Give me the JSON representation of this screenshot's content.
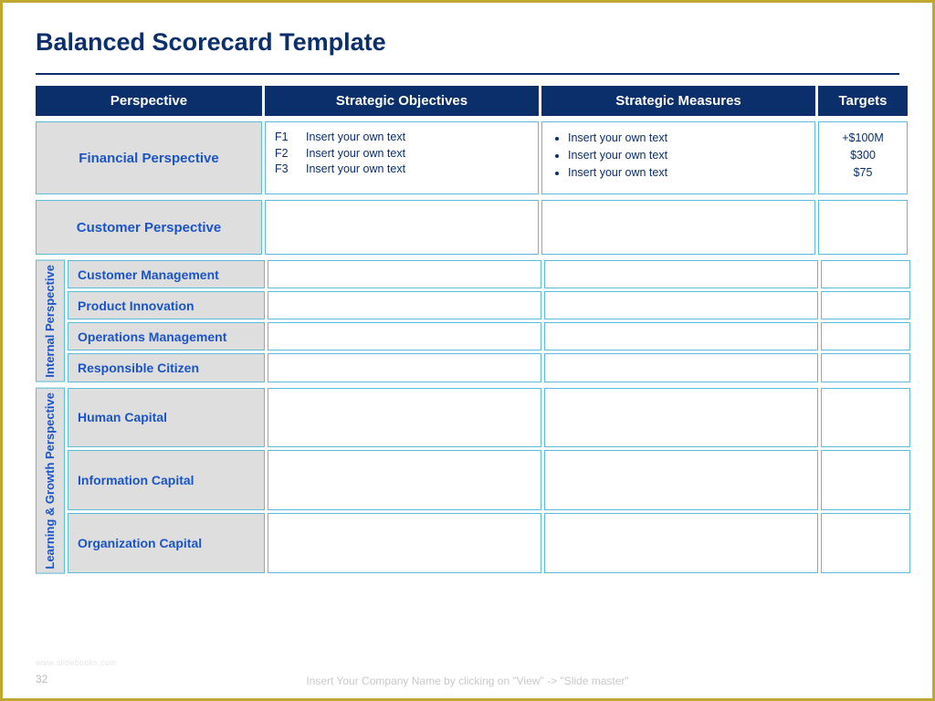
{
  "title": "Balanced Scorecard Template",
  "headers": {
    "perspective": "Perspective",
    "objectives": "Strategic Objectives",
    "measures": "Strategic Measures",
    "targets": "Targets"
  },
  "financial": {
    "label": "Financial Perspective",
    "objectives": [
      {
        "key": "F1",
        "text": "Insert your own text"
      },
      {
        "key": "F2",
        "text": "Insert your own text"
      },
      {
        "key": "F3",
        "text": "Insert your own text"
      }
    ],
    "measures": [
      "Insert your own text",
      "Insert your own text",
      "Insert your own text"
    ],
    "targets": [
      "+$100M",
      "$300",
      "$75"
    ]
  },
  "customer": {
    "label": "Customer Perspective"
  },
  "internal": {
    "vertical_label": "Internal Perspective",
    "rows": [
      "Customer Management",
      "Product Innovation",
      "Operations Management",
      "Responsible Citizen"
    ]
  },
  "learning": {
    "vertical_label": "Learning & Growth Perspective",
    "rows": [
      "Human Capital",
      "Information Capital",
      "Organization Capital"
    ]
  },
  "footer": {
    "page_number": "32",
    "instruction": "Insert Your Company Name by clicking on \"View\" -> \"Slide master\"",
    "watermark": "www.slidebooks.com"
  }
}
